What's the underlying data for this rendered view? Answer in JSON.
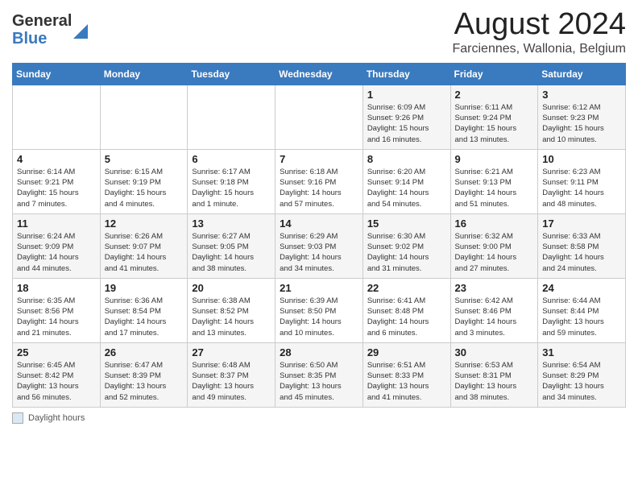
{
  "header": {
    "logo_general": "General",
    "logo_blue": "Blue",
    "month_year": "August 2024",
    "location": "Farciennes, Wallonia, Belgium"
  },
  "days_of_week": [
    "Sunday",
    "Monday",
    "Tuesday",
    "Wednesday",
    "Thursday",
    "Friday",
    "Saturday"
  ],
  "footer": {
    "label": "Daylight hours"
  },
  "weeks": [
    [
      {
        "day": "",
        "info": ""
      },
      {
        "day": "",
        "info": ""
      },
      {
        "day": "",
        "info": ""
      },
      {
        "day": "",
        "info": ""
      },
      {
        "day": "1",
        "info": "Sunrise: 6:09 AM\nSunset: 9:26 PM\nDaylight: 15 hours\nand 16 minutes."
      },
      {
        "day": "2",
        "info": "Sunrise: 6:11 AM\nSunset: 9:24 PM\nDaylight: 15 hours\nand 13 minutes."
      },
      {
        "day": "3",
        "info": "Sunrise: 6:12 AM\nSunset: 9:23 PM\nDaylight: 15 hours\nand 10 minutes."
      }
    ],
    [
      {
        "day": "4",
        "info": "Sunrise: 6:14 AM\nSunset: 9:21 PM\nDaylight: 15 hours\nand 7 minutes."
      },
      {
        "day": "5",
        "info": "Sunrise: 6:15 AM\nSunset: 9:19 PM\nDaylight: 15 hours\nand 4 minutes."
      },
      {
        "day": "6",
        "info": "Sunrise: 6:17 AM\nSunset: 9:18 PM\nDaylight: 15 hours\nand 1 minute."
      },
      {
        "day": "7",
        "info": "Sunrise: 6:18 AM\nSunset: 9:16 PM\nDaylight: 14 hours\nand 57 minutes."
      },
      {
        "day": "8",
        "info": "Sunrise: 6:20 AM\nSunset: 9:14 PM\nDaylight: 14 hours\nand 54 minutes."
      },
      {
        "day": "9",
        "info": "Sunrise: 6:21 AM\nSunset: 9:13 PM\nDaylight: 14 hours\nand 51 minutes."
      },
      {
        "day": "10",
        "info": "Sunrise: 6:23 AM\nSunset: 9:11 PM\nDaylight: 14 hours\nand 48 minutes."
      }
    ],
    [
      {
        "day": "11",
        "info": "Sunrise: 6:24 AM\nSunset: 9:09 PM\nDaylight: 14 hours\nand 44 minutes."
      },
      {
        "day": "12",
        "info": "Sunrise: 6:26 AM\nSunset: 9:07 PM\nDaylight: 14 hours\nand 41 minutes."
      },
      {
        "day": "13",
        "info": "Sunrise: 6:27 AM\nSunset: 9:05 PM\nDaylight: 14 hours\nand 38 minutes."
      },
      {
        "day": "14",
        "info": "Sunrise: 6:29 AM\nSunset: 9:03 PM\nDaylight: 14 hours\nand 34 minutes."
      },
      {
        "day": "15",
        "info": "Sunrise: 6:30 AM\nSunset: 9:02 PM\nDaylight: 14 hours\nand 31 minutes."
      },
      {
        "day": "16",
        "info": "Sunrise: 6:32 AM\nSunset: 9:00 PM\nDaylight: 14 hours\nand 27 minutes."
      },
      {
        "day": "17",
        "info": "Sunrise: 6:33 AM\nSunset: 8:58 PM\nDaylight: 14 hours\nand 24 minutes."
      }
    ],
    [
      {
        "day": "18",
        "info": "Sunrise: 6:35 AM\nSunset: 8:56 PM\nDaylight: 14 hours\nand 21 minutes."
      },
      {
        "day": "19",
        "info": "Sunrise: 6:36 AM\nSunset: 8:54 PM\nDaylight: 14 hours\nand 17 minutes."
      },
      {
        "day": "20",
        "info": "Sunrise: 6:38 AM\nSunset: 8:52 PM\nDaylight: 14 hours\nand 13 minutes."
      },
      {
        "day": "21",
        "info": "Sunrise: 6:39 AM\nSunset: 8:50 PM\nDaylight: 14 hours\nand 10 minutes."
      },
      {
        "day": "22",
        "info": "Sunrise: 6:41 AM\nSunset: 8:48 PM\nDaylight: 14 hours\nand 6 minutes."
      },
      {
        "day": "23",
        "info": "Sunrise: 6:42 AM\nSunset: 8:46 PM\nDaylight: 14 hours\nand 3 minutes."
      },
      {
        "day": "24",
        "info": "Sunrise: 6:44 AM\nSunset: 8:44 PM\nDaylight: 13 hours\nand 59 minutes."
      }
    ],
    [
      {
        "day": "25",
        "info": "Sunrise: 6:45 AM\nSunset: 8:42 PM\nDaylight: 13 hours\nand 56 minutes."
      },
      {
        "day": "26",
        "info": "Sunrise: 6:47 AM\nSunset: 8:39 PM\nDaylight: 13 hours\nand 52 minutes."
      },
      {
        "day": "27",
        "info": "Sunrise: 6:48 AM\nSunset: 8:37 PM\nDaylight: 13 hours\nand 49 minutes."
      },
      {
        "day": "28",
        "info": "Sunrise: 6:50 AM\nSunset: 8:35 PM\nDaylight: 13 hours\nand 45 minutes."
      },
      {
        "day": "29",
        "info": "Sunrise: 6:51 AM\nSunset: 8:33 PM\nDaylight: 13 hours\nand 41 minutes."
      },
      {
        "day": "30",
        "info": "Sunrise: 6:53 AM\nSunset: 8:31 PM\nDaylight: 13 hours\nand 38 minutes."
      },
      {
        "day": "31",
        "info": "Sunrise: 6:54 AM\nSunset: 8:29 PM\nDaylight: 13 hours\nand 34 minutes."
      }
    ]
  ]
}
